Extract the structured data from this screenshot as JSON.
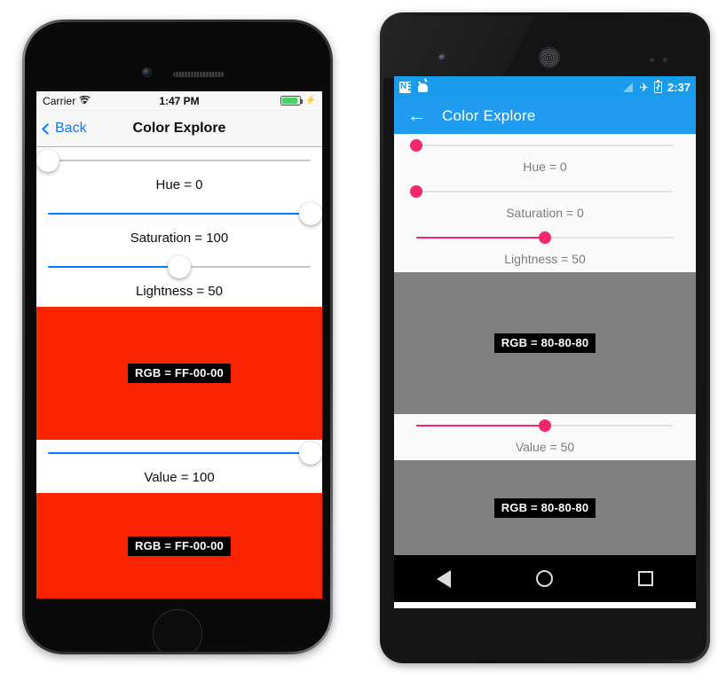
{
  "ios": {
    "status": {
      "carrier": "Carrier",
      "wifi_icon": "wifi-icon",
      "time": "1:47 PM",
      "battery_icon": "battery-full-icon",
      "charging_icon": "lightning-bolt-icon"
    },
    "navbar": {
      "back_label": "Back",
      "back_icon": "chevron-left-icon",
      "title": "Color Explore"
    },
    "controls": [
      {
        "name": "hue",
        "label": "Hue = 0",
        "value": 0,
        "fill_pct": 0,
        "thumb_pct": 0
      },
      {
        "name": "saturation",
        "label": "Saturation = 100",
        "value": 100,
        "fill_pct": 100,
        "thumb_pct": 100
      },
      {
        "name": "lightness",
        "label": "Lightness = 50",
        "value": 50,
        "fill_pct": 50,
        "thumb_pct": 50
      },
      {
        "name": "value",
        "label": "Value = 100",
        "value": 100,
        "fill_pct": 100,
        "thumb_pct": 100
      }
    ],
    "swatches": [
      {
        "name": "hsl-swatch",
        "rgb_label": "RGB = FF-00-00",
        "color": "#FA2400"
      },
      {
        "name": "hsv-swatch",
        "rgb_label": "RGB = FF-00-00",
        "color": "#FA2400"
      }
    ],
    "colors": {
      "accent": "#087AFF",
      "track": "#C6C6C8",
      "status_bg": "#F7F7F7"
    }
  },
  "android": {
    "status": {
      "onenote_icon": "onenote-icon",
      "android_icon": "android-robot-icon",
      "signal_icon": "signal-no-service-icon",
      "airplane_icon": "airplane-mode-icon",
      "battery_icon": "battery-charging-icon",
      "time": "2:37"
    },
    "appbar": {
      "back_icon": "arrow-left-icon",
      "title": "Color Explore"
    },
    "controls": [
      {
        "name": "hue",
        "label": "Hue = 0",
        "value": 0,
        "fill_pct": 0,
        "thumb_pct": 0
      },
      {
        "name": "saturation",
        "label": "Saturation = 0",
        "value": 0,
        "fill_pct": 0,
        "thumb_pct": 0
      },
      {
        "name": "lightness",
        "label": "Lightness = 50",
        "value": 50,
        "fill_pct": 50,
        "thumb_pct": 50
      },
      {
        "name": "value",
        "label": "Value = 50",
        "value": 50,
        "fill_pct": 50,
        "thumb_pct": 50
      }
    ],
    "swatches": [
      {
        "name": "hsl-swatch",
        "rgb_label": "RGB = 80-80-80",
        "color": "#808080"
      },
      {
        "name": "hsv-swatch",
        "rgb_label": "RGB = 80-80-80",
        "color": "#808080"
      }
    ],
    "navbar": {
      "back_icon": "nav-back-triangle-icon",
      "home_icon": "nav-home-circle-icon",
      "recents_icon": "nav-recents-square-icon"
    },
    "colors": {
      "accent": "#F4286E",
      "appbar": "#1F9BF0",
      "status_bg": "#1A9CED"
    }
  }
}
